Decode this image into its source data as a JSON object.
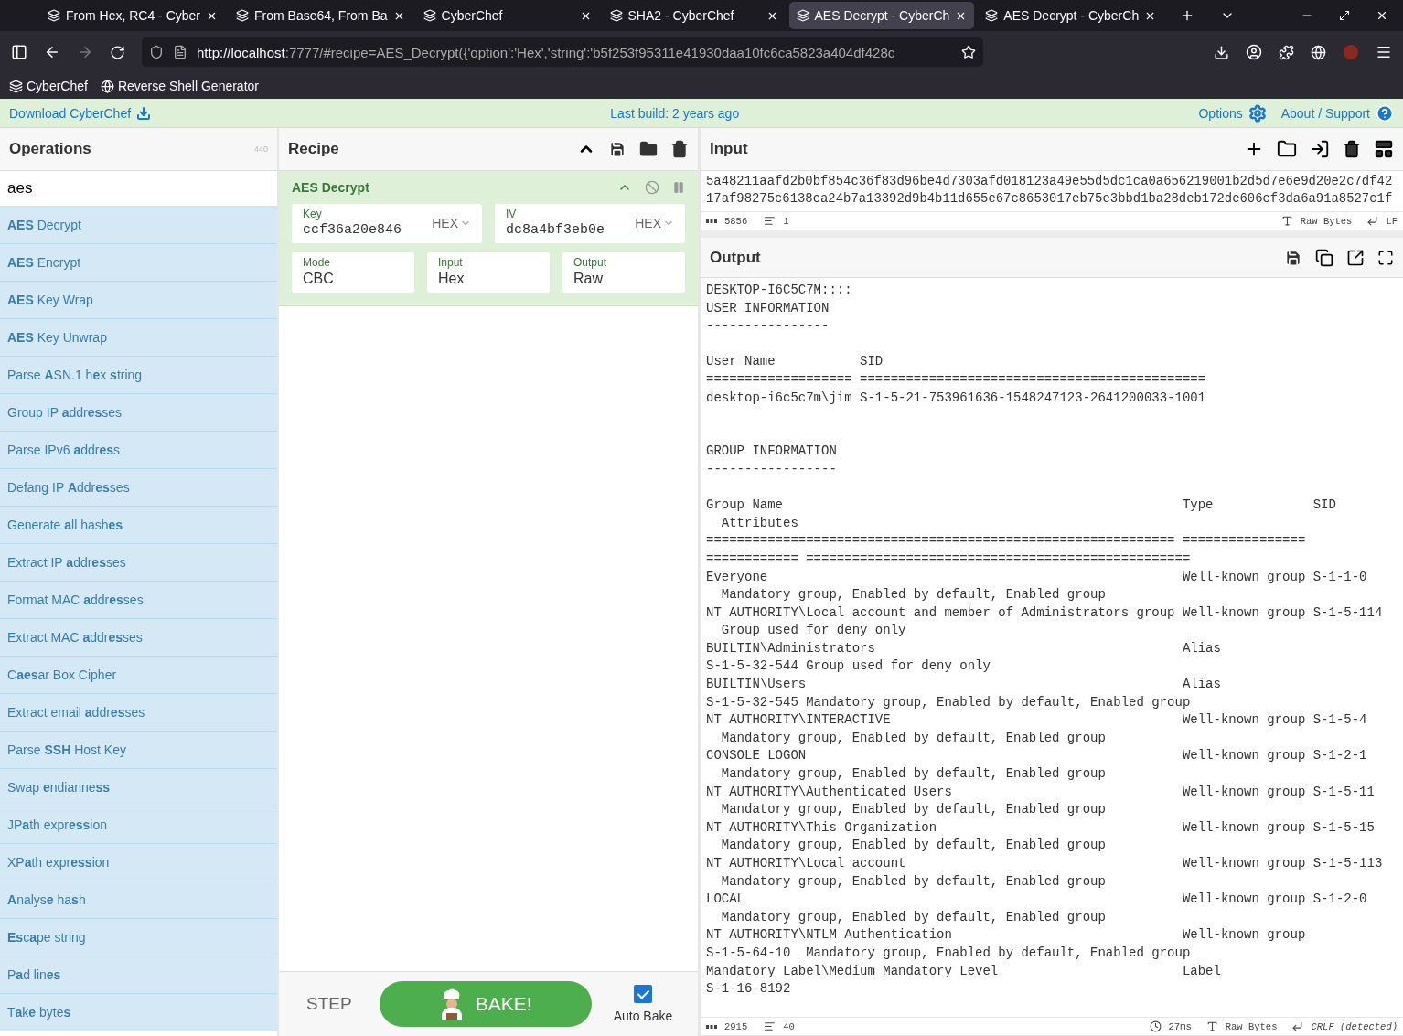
{
  "browser": {
    "tabs": [
      {
        "title": "From Hex, RC4 - Cyber",
        "selected": false
      },
      {
        "title": "From Base64, From Ba",
        "selected": false
      },
      {
        "title": "CyberChef",
        "selected": false
      },
      {
        "title": "SHA2 - CyberChef",
        "selected": false
      },
      {
        "title": "AES Decrypt - CyberCh",
        "selected": true
      },
      {
        "title": "AES Decrypt - CyberCh",
        "selected": false
      }
    ],
    "url": {
      "host": "http://localhost",
      "rest": ":7777/#recipe=AES_Decrypt({'option':'Hex','string':'b5f253f95311e41930daa10fc6ca5823a404df428c"
    },
    "bookmarks": [
      {
        "kind": "chef",
        "label": "CyberChef"
      },
      {
        "kind": "globe",
        "label": "Reverse Shell Generator"
      }
    ]
  },
  "banner": {
    "download": "Download CyberChef",
    "build": "Last build: 2 years ago",
    "options": "Options",
    "about": "About / Support"
  },
  "operations": {
    "title": "Operations",
    "count": "440",
    "search": "aes",
    "items": [
      "**AES** Decrypt",
      "**AES** Encrypt",
      "**AES** Key Wrap",
      "**AES** Key Unwrap",
      "Parse **A**SN.1 h**e**x **s**tring",
      "Group IP **a**ddr**es**ses",
      "Parse IPv6 **a**ddr**es**s",
      "Defang IP **A**ddr**es**ses",
      "Generate **a**ll hash**es**",
      "Extract IP **a**ddr**es**ses",
      "Format MAC **a**ddr**es**ses",
      "Extract MAC **a**ddr**es**ses",
      "C**aes**ar Box Cipher",
      "Extract email **a**ddr**es**ses",
      "Parse **SSH** Host Key",
      "Swap **e**ndianne**ss**",
      "JP**a**th expr**ess**ion",
      "XP**a**th expr**ess**ion",
      "**A**nalys**e** ha**s**h",
      "**Es**c**a**pe string",
      "P**a**d lin**es**",
      "T**a**k**e** byte**s**"
    ]
  },
  "recipe": {
    "title": "Recipe",
    "operation": {
      "name": "AES Decrypt",
      "args": [
        {
          "kind": "toggle",
          "label": "Key",
          "value": "ccf36a20e846",
          "toggle": "HEX"
        },
        {
          "kind": "toggle",
          "label": "IV",
          "value": "dc8a4bf3eb0e",
          "toggle": "HEX"
        },
        {
          "kind": "select",
          "label": "Mode",
          "value": "CBC"
        },
        {
          "kind": "select",
          "label": "Input",
          "value": "Hex"
        },
        {
          "kind": "select",
          "label": "Output",
          "value": "Raw"
        }
      ]
    },
    "step": "STEP",
    "bake": "BAKE!",
    "auto_bake": {
      "label": "Auto Bake",
      "checked": true
    }
  },
  "input": {
    "title": "Input",
    "lines": [
      "5a48211aafd2b0bf854c36f83d96be4d7303afd018123a49e55d5dc1ca0a656219001b2d5d7e6e9d20e2c7df42",
      "17af98275c6138ca24b7a13392d9b4b11d655e67c8653017eb75e3bbd1ba28deb172de606cf3da6a91a8527c1f"
    ],
    "status": {
      "chars": "5856",
      "lines": "1",
      "encoding": "Raw Bytes",
      "eol": "LF"
    }
  },
  "output": {
    "title": "Output",
    "lines": [
      {
        "kind": "text",
        "text": "DESKTOP-I6C5C7M::::"
      },
      {
        "kind": "text",
        "text": "USER INFORMATION"
      },
      {
        "kind": "text",
        "text": "----------------"
      },
      {
        "kind": "blank"
      },
      {
        "kind": "text",
        "text": "User Name           SID"
      },
      {
        "kind": "text",
        "text": "=================== ============================================="
      },
      {
        "kind": "text",
        "text": "desktop-i6c5c7m\\jim S-1-5-21-753961636-1548247123-2641200033-1001"
      },
      {
        "kind": "blank"
      },
      {
        "kind": "blank"
      },
      {
        "kind": "text",
        "text": "GROUP INFORMATION"
      },
      {
        "kind": "text",
        "text": "-----------------"
      },
      {
        "kind": "blank"
      },
      {
        "kind": "text",
        "text": "Group Name                                                    Type             SID"
      },
      {
        "kind": "text",
        "text": "  Attributes"
      },
      {
        "kind": "text",
        "text": "============================================================= ================"
      },
      {
        "kind": "text",
        "text": "============ =================================================="
      },
      {
        "kind": "text",
        "text": "Everyone                                                      Well-known group S-1-1-0"
      },
      {
        "kind": "text",
        "text": "  Mandatory group, Enabled by default, Enabled group"
      },
      {
        "kind": "text",
        "text": "NT AUTHORITY\\Local account and member of Administrators group Well-known group S-1-5-114"
      },
      {
        "kind": "text",
        "text": "  Group used for deny only"
      },
      {
        "kind": "text",
        "text": "BUILTIN\\Administrators                                        Alias"
      },
      {
        "kind": "text",
        "text": "S-1-5-32-544 Group used for deny only"
      },
      {
        "kind": "text",
        "text": "BUILTIN\\Users                                                 Alias"
      },
      {
        "kind": "text",
        "text": "S-1-5-32-545 Mandatory group, Enabled by default, Enabled group"
      },
      {
        "kind": "text",
        "text": "NT AUTHORITY\\INTERACTIVE                                      Well-known group S-1-5-4"
      },
      {
        "kind": "text",
        "text": "  Mandatory group, Enabled by default, Enabled group"
      },
      {
        "kind": "text",
        "text": "CONSOLE LOGON                                                 Well-known group S-1-2-1"
      },
      {
        "kind": "text",
        "text": "  Mandatory group, Enabled by default, Enabled group"
      },
      {
        "kind": "text",
        "text": "NT AUTHORITY\\Authenticated Users                              Well-known group S-1-5-11"
      },
      {
        "kind": "text",
        "text": "  Mandatory group, Enabled by default, Enabled group"
      },
      {
        "kind": "text",
        "text": "NT AUTHORITY\\This Organization                                Well-known group S-1-5-15"
      },
      {
        "kind": "text",
        "text": "  Mandatory group, Enabled by default, Enabled group"
      },
      {
        "kind": "text",
        "text": "NT AUTHORITY\\Local account                                    Well-known group S-1-5-113"
      },
      {
        "kind": "text",
        "text": "  Mandatory group, Enabled by default, Enabled group"
      },
      {
        "kind": "text",
        "text": "LOCAL                                                         Well-known group S-1-2-0"
      },
      {
        "kind": "text",
        "text": "  Mandatory group, Enabled by default, Enabled group"
      },
      {
        "kind": "text",
        "text": "NT AUTHORITY\\NTLM Authentication                              Well-known group"
      },
      {
        "kind": "text",
        "text": "S-1-5-64-10  Mandatory group, Enabled by default, Enabled group"
      },
      {
        "kind": "text",
        "text": "Mandatory Label\\Medium Mandatory Level                        Label"
      },
      {
        "kind": "text",
        "text": "S-1-16-8192"
      }
    ],
    "status": {
      "chars": "2915",
      "lines": "40",
      "time": "27ms",
      "encoding": "Raw Bytes",
      "eol": "CRLF (detected)"
    }
  }
}
